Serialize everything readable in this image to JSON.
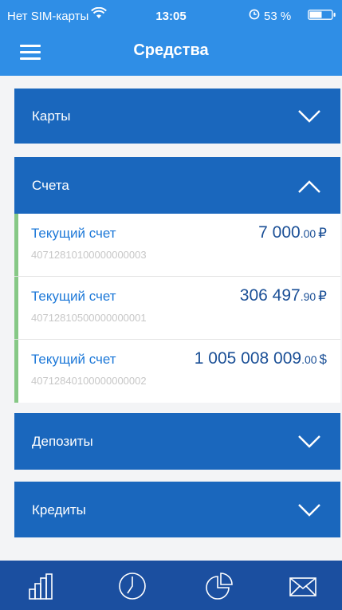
{
  "status_bar": {
    "carrier": "Нет SIM-карты",
    "time": "13:05",
    "battery": "53 %",
    "icons": [
      "wifi-icon",
      "alarm-icon",
      "battery-icon"
    ]
  },
  "nav": {
    "title": "Средства",
    "menu_icon": "hamburger-icon"
  },
  "sections": {
    "cards": {
      "label": "Карты",
      "expanded": false
    },
    "accounts": {
      "label": "Счета",
      "expanded": true,
      "items": [
        {
          "name": "Текущий счет",
          "number": "40712810100000000003",
          "whole": "7 000",
          "fraction": ".00",
          "currency": "₽"
        },
        {
          "name": "Текущий счет",
          "number": "40712810500000000001",
          "whole": "306 497",
          "fraction": ".90",
          "currency": "₽"
        },
        {
          "name": "Текущий счет",
          "number": "40712840100000000002",
          "whole": "1 005 008 009",
          "fraction": ".00",
          "currency": "$"
        }
      ]
    },
    "deposits": {
      "label": "Депозиты",
      "expanded": false
    },
    "credits": {
      "label": "Кредиты",
      "expanded": false
    }
  },
  "tab_bar": {
    "tabs": [
      "bar-chart-icon",
      "clock-icon",
      "pie-chart-icon",
      "envelope-icon"
    ]
  },
  "colors": {
    "header": "#2f8ee6",
    "section": "#1a67bd",
    "tab_bar": "#1b4fa0",
    "account_name": "#1c78d8",
    "amount": "#1a4f96",
    "marker": "#86c886"
  }
}
